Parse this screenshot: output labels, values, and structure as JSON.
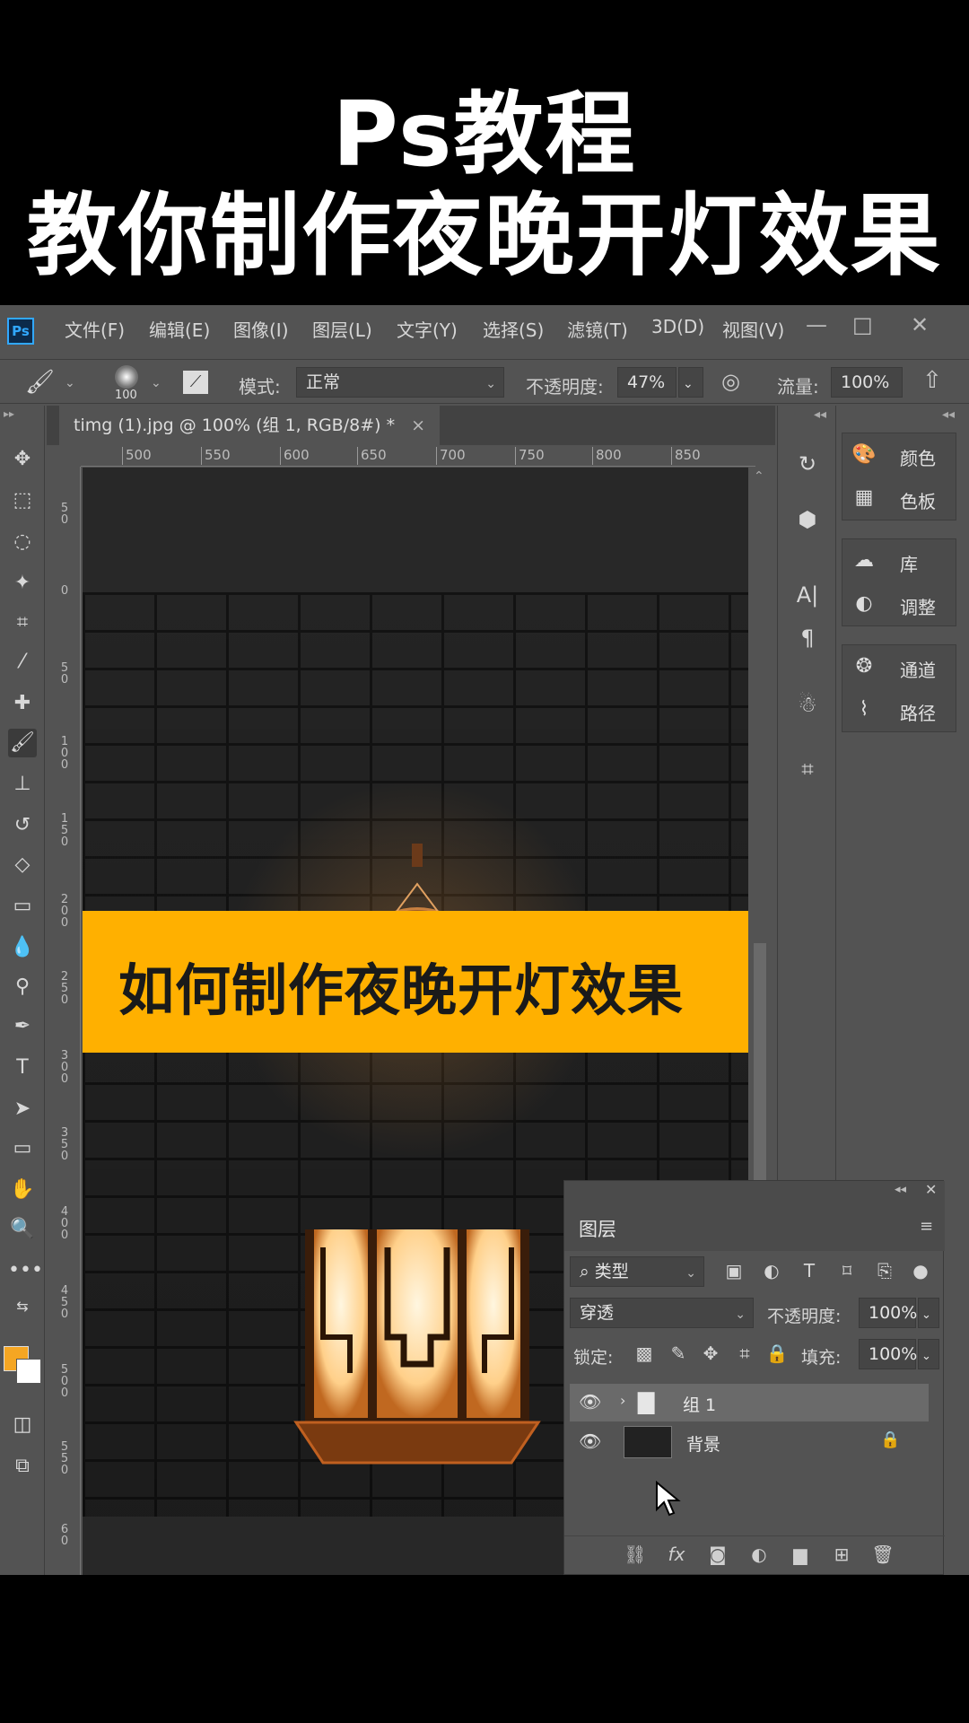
{
  "video": {
    "title_line1": "Ps教程",
    "title_line2": "教你制作夜晚开灯效果"
  },
  "app": {
    "logo": "Ps",
    "menu": [
      "文件(F)",
      "编辑(E)",
      "图像(I)",
      "图层(L)",
      "文字(Y)",
      "选择(S)",
      "滤镜(T)",
      "3D(D)",
      "视图(V)"
    ],
    "window_controls": [
      "—",
      "□",
      "✕"
    ]
  },
  "options_bar": {
    "brush_size": "100",
    "mode_label": "模式:",
    "mode_value": "正常",
    "opacity_label": "不透明度:",
    "opacity_value": "47%",
    "flow_label": "流量:",
    "flow_value": "100%"
  },
  "document": {
    "tab_title": "timg (1).jpg @ 100% (组 1, RGB/8#) *",
    "close": "×",
    "ruler_top": [
      "500",
      "550",
      "600",
      "650",
      "700",
      "750",
      "800",
      "850"
    ],
    "ruler_left": [
      "5\n0",
      "0",
      "5\n0",
      "1\n0\n0",
      "1\n5\n0",
      "2\n0\n0",
      "2\n5\n0",
      "3\n0\n0",
      "3\n5\n0",
      "4\n0\n0",
      "4\n5\n0",
      "5\n0\n0",
      "5\n5\n0",
      "6\n0"
    ],
    "banner_text": "如何制作夜晚开灯效果"
  },
  "panels": {
    "group1": [
      {
        "icon": "palette-icon",
        "label": "颜色"
      },
      {
        "icon": "grid-icon",
        "label": "色板"
      }
    ],
    "group2": [
      {
        "icon": "library-icon",
        "label": "库"
      },
      {
        "icon": "adjust-icon",
        "label": "调整"
      }
    ],
    "group3": [
      {
        "icon": "channels-icon",
        "label": "通道"
      },
      {
        "icon": "paths-icon",
        "label": "路径"
      }
    ]
  },
  "layers_panel": {
    "tab_label": "图层",
    "filter_label": "类型",
    "blend_mode": "穿透",
    "opacity_label": "不透明度:",
    "opacity_value": "100%",
    "lock_label": "锁定:",
    "fill_label": "填充:",
    "fill_value": "100%",
    "layers": [
      {
        "name": "组 1",
        "type": "group",
        "selected": true
      },
      {
        "name": "背景",
        "type": "image",
        "locked": true
      }
    ],
    "footer_fx": "fx"
  },
  "colors": {
    "foreground": "#f5a623",
    "background": "#ffffff",
    "banner": "#ffb000",
    "ps_accent": "#31a8ff"
  }
}
